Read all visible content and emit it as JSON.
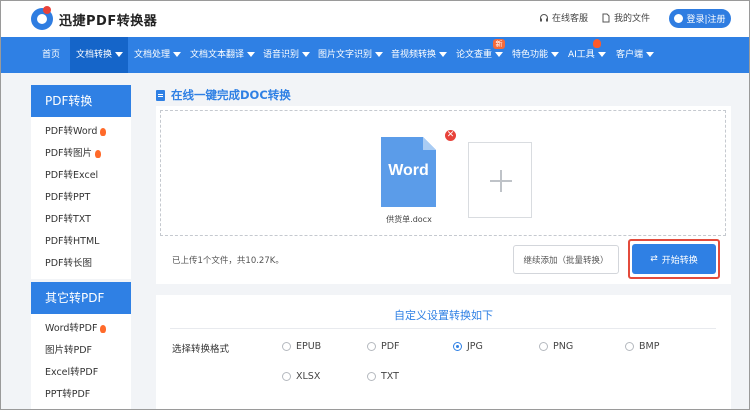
{
  "header": {
    "brand": "迅捷PDF转换器",
    "help_label": "在线客服",
    "files_label": "我的文件",
    "login_label": "登录|注册"
  },
  "nav": {
    "items": [
      {
        "label": "首页"
      },
      {
        "label": "文档转换",
        "active": true
      },
      {
        "label": "文档处理"
      },
      {
        "label": "文档文本翻译"
      },
      {
        "label": "语音识别"
      },
      {
        "label": "图片文字识别"
      },
      {
        "label": "音视频转换"
      },
      {
        "label": "论文查重"
      },
      {
        "label": "特色功能"
      },
      {
        "label": "AI工具"
      },
      {
        "label": "客户端"
      }
    ],
    "new_badge": "新"
  },
  "sidebar": {
    "pdf_head": "PDF转换",
    "pdf_items": [
      {
        "label": "PDF转Word",
        "hot": true
      },
      {
        "label": "PDF转图片",
        "hot": true
      },
      {
        "label": "PDF转Excel"
      },
      {
        "label": "PDF转PPT"
      },
      {
        "label": "PDF转TXT"
      },
      {
        "label": "PDF转HTML"
      },
      {
        "label": "PDF转长图"
      }
    ],
    "other_head": "其它转PDF",
    "other_items": [
      {
        "label": "Word转PDF",
        "hot": true
      },
      {
        "label": "图片转PDF"
      },
      {
        "label": "Excel转PDF"
      },
      {
        "label": "PPT转PDF"
      }
    ]
  },
  "main": {
    "title": "在线一键完成DOC转换",
    "file_icon_text": "Word",
    "file_name": "供货单.docx",
    "status": "已上传1个文件，共10.27K。",
    "continue_label": "继续添加（批量转换）",
    "start_label": "开始转换"
  },
  "settings": {
    "title": "自定义设置转换如下",
    "format_label": "选择转换格式",
    "options": [
      {
        "label": "EPUB",
        "selected": false
      },
      {
        "label": "PDF",
        "selected": false
      },
      {
        "label": "JPG",
        "selected": true
      },
      {
        "label": "PNG",
        "selected": false
      },
      {
        "label": "BMP",
        "selected": false
      },
      {
        "label": "XLSX",
        "selected": false
      },
      {
        "label": "TXT",
        "selected": false
      }
    ]
  },
  "colors": {
    "accent": "#2f80e4",
    "nav_active": "#1565c9",
    "highlight": "#e34b3c",
    "hot": "#ff6a2a"
  }
}
